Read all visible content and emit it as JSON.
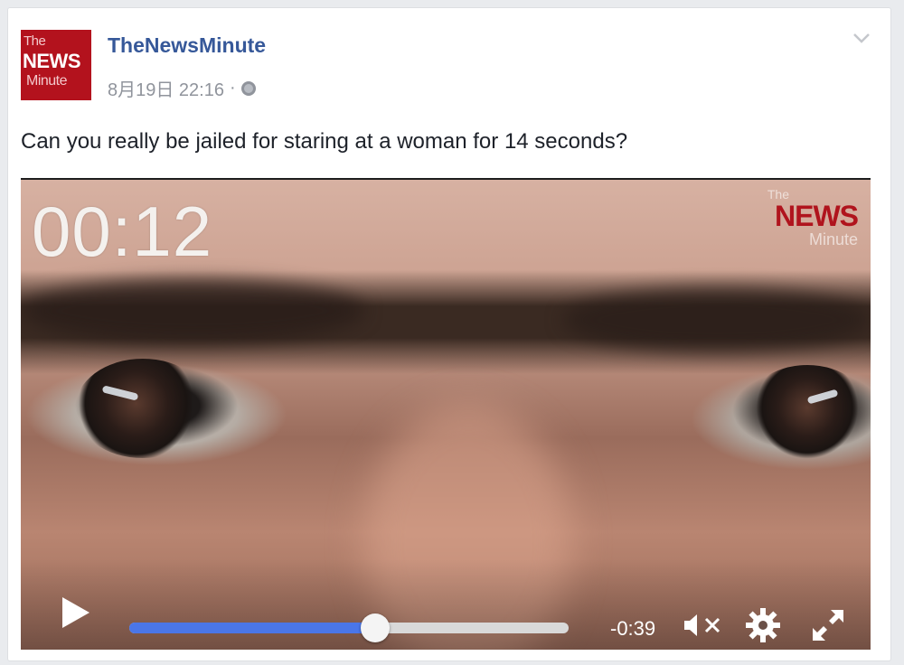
{
  "post": {
    "page_name": "TheNewsMinute",
    "timestamp": "8月19日 22:16",
    "separator": "·",
    "privacy_icon": "globe-icon",
    "menu_icon": "chevron-down-icon",
    "text": "Can you really be jailed for staring at a woman for 14 seconds?"
  },
  "avatar": {
    "line1": "The",
    "line2": "NEWS",
    "line3": "Minute"
  },
  "video": {
    "overlay_timer": "00:12",
    "watermark": {
      "line1": "The",
      "line2": "NEWS",
      "line3": "Minute"
    },
    "controls": {
      "play_icon": "play-icon",
      "progress_fraction": 0.56,
      "time_remaining": "-0:39",
      "mute_icon": "muted-speaker-icon",
      "settings_icon": "gear-icon",
      "fullscreen_icon": "expand-icon"
    }
  },
  "colors": {
    "brand_red": "#b3121d",
    "link_blue": "#365899",
    "progress_blue": "#4a76e8"
  }
}
